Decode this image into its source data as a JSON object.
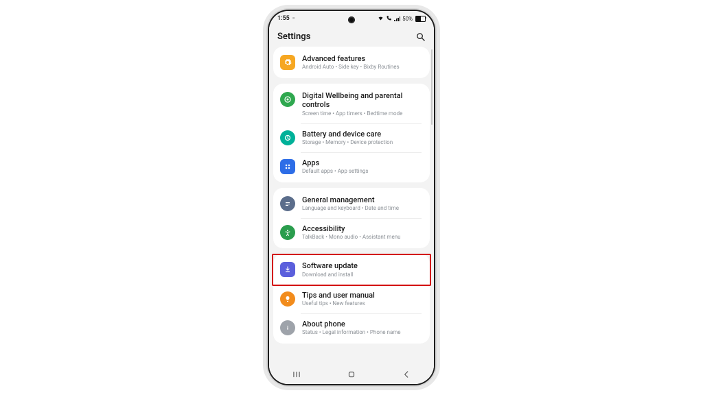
{
  "status": {
    "time": "1:55",
    "battery_label": "50%"
  },
  "header": {
    "title": "Settings"
  },
  "groups": [
    {
      "items": [
        {
          "icon": "advanced-features-icon",
          "icon_cls": "ic-yellow",
          "title": "Advanced features",
          "subtitle": "Android Auto • Side key • Bixby Routines"
        }
      ]
    },
    {
      "items": [
        {
          "icon": "wellbeing-icon",
          "icon_cls": "ic-green",
          "title": "Digital Wellbeing and parental controls",
          "subtitle": "Screen time • App timers • Bedtime mode"
        },
        {
          "icon": "battery-care-icon",
          "icon_cls": "ic-teal",
          "title": "Battery and device care",
          "subtitle": "Storage • Memory • Device protection"
        },
        {
          "icon": "apps-icon",
          "icon_cls": "ic-blue",
          "title": "Apps",
          "subtitle": "Default apps • App settings"
        }
      ]
    },
    {
      "items": [
        {
          "icon": "general-icon",
          "icon_cls": "ic-slate",
          "title": "General management",
          "subtitle": "Language and keyboard • Date and time"
        },
        {
          "icon": "accessibility-icon",
          "icon_cls": "ic-green2",
          "title": "Accessibility",
          "subtitle": "TalkBack • Mono audio • Assistant menu"
        }
      ]
    },
    {
      "items": [
        {
          "icon": "update-icon",
          "icon_cls": "ic-violet",
          "title": "Software update",
          "subtitle": "Download and install",
          "highlight": true
        },
        {
          "icon": "tips-icon",
          "icon_cls": "ic-orange",
          "title": "Tips and user manual",
          "subtitle": "Useful tips • New features"
        },
        {
          "icon": "about-icon",
          "icon_cls": "ic-grey",
          "title": "About phone",
          "subtitle": "Status • Legal information • Phone name"
        }
      ]
    }
  ]
}
